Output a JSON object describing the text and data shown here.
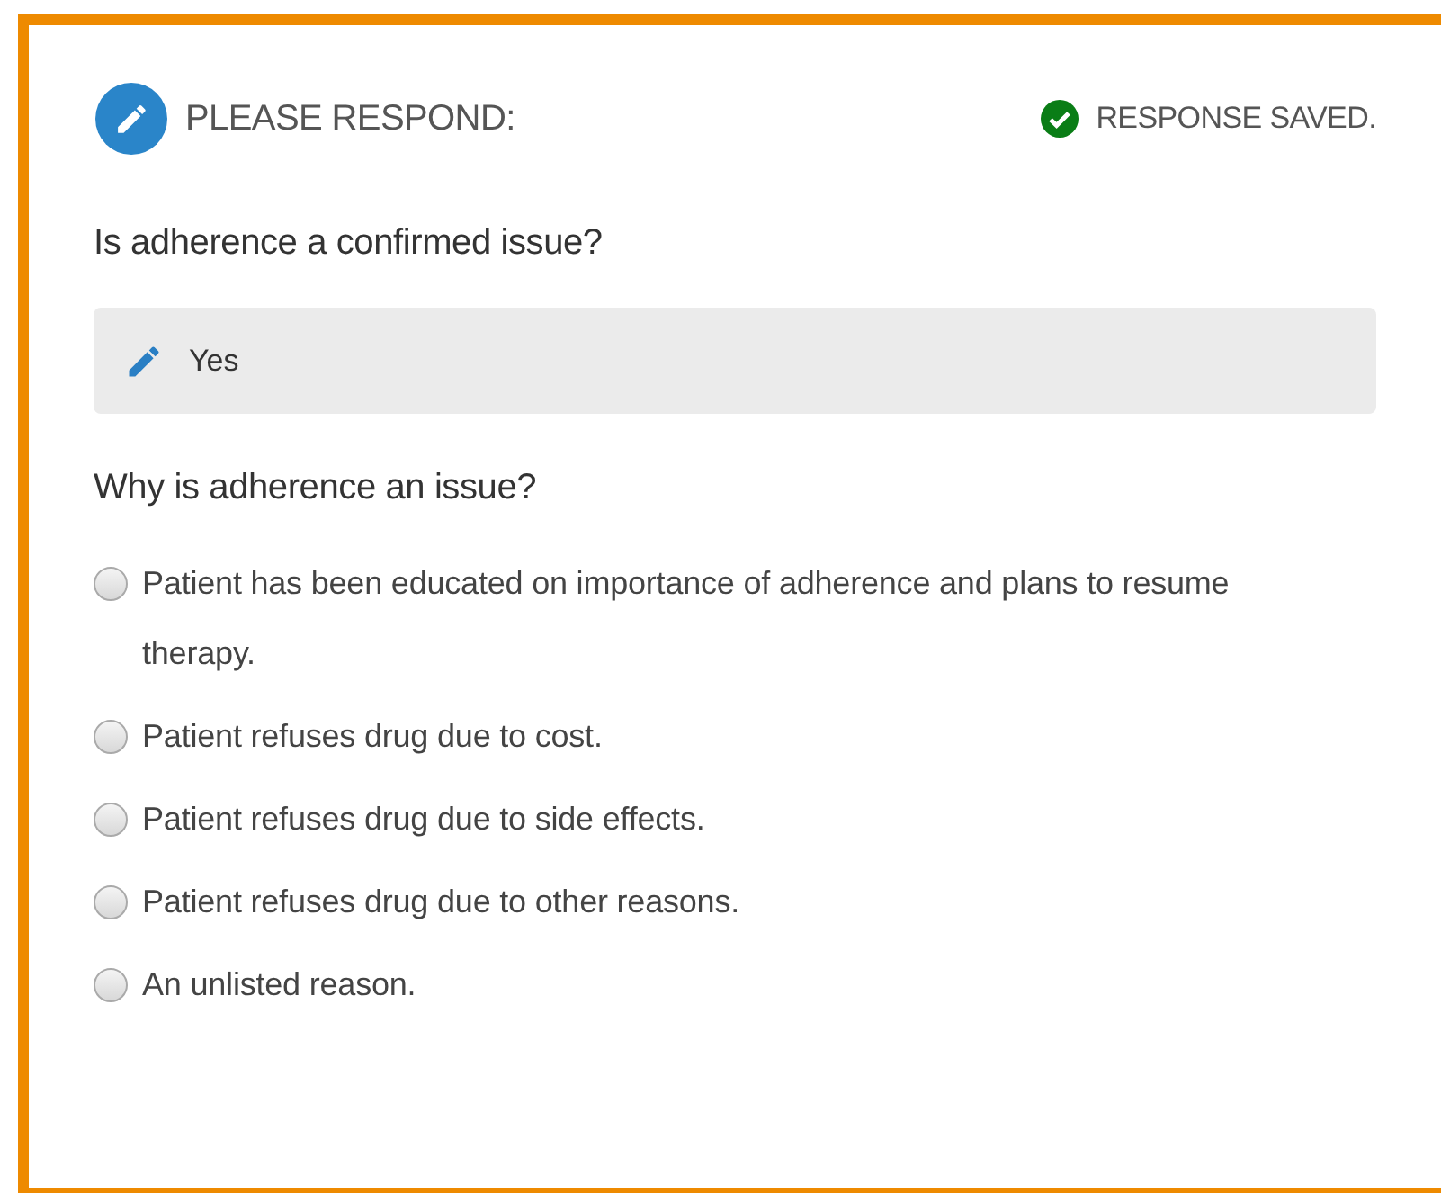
{
  "header": {
    "title": "PLEASE RESPOND:",
    "status": "RESPONSE SAVED."
  },
  "questions": [
    {
      "kind": "answered",
      "prompt": "Is adherence a confirmed issue?",
      "answer": "Yes"
    },
    {
      "kind": "choice",
      "prompt": "Why is adherence an issue?",
      "options": [
        {
          "label": "Patient has been educated on importance of adherence and plans to resume therapy.",
          "selected": false
        },
        {
          "label": "Patient refuses drug due to cost.",
          "selected": false
        },
        {
          "label": "Patient refuses drug due to side effects.",
          "selected": false
        },
        {
          "label": "Patient refuses drug due to other reasons.",
          "selected": false
        },
        {
          "label": "An unlisted reason.",
          "selected": false
        }
      ]
    }
  ]
}
